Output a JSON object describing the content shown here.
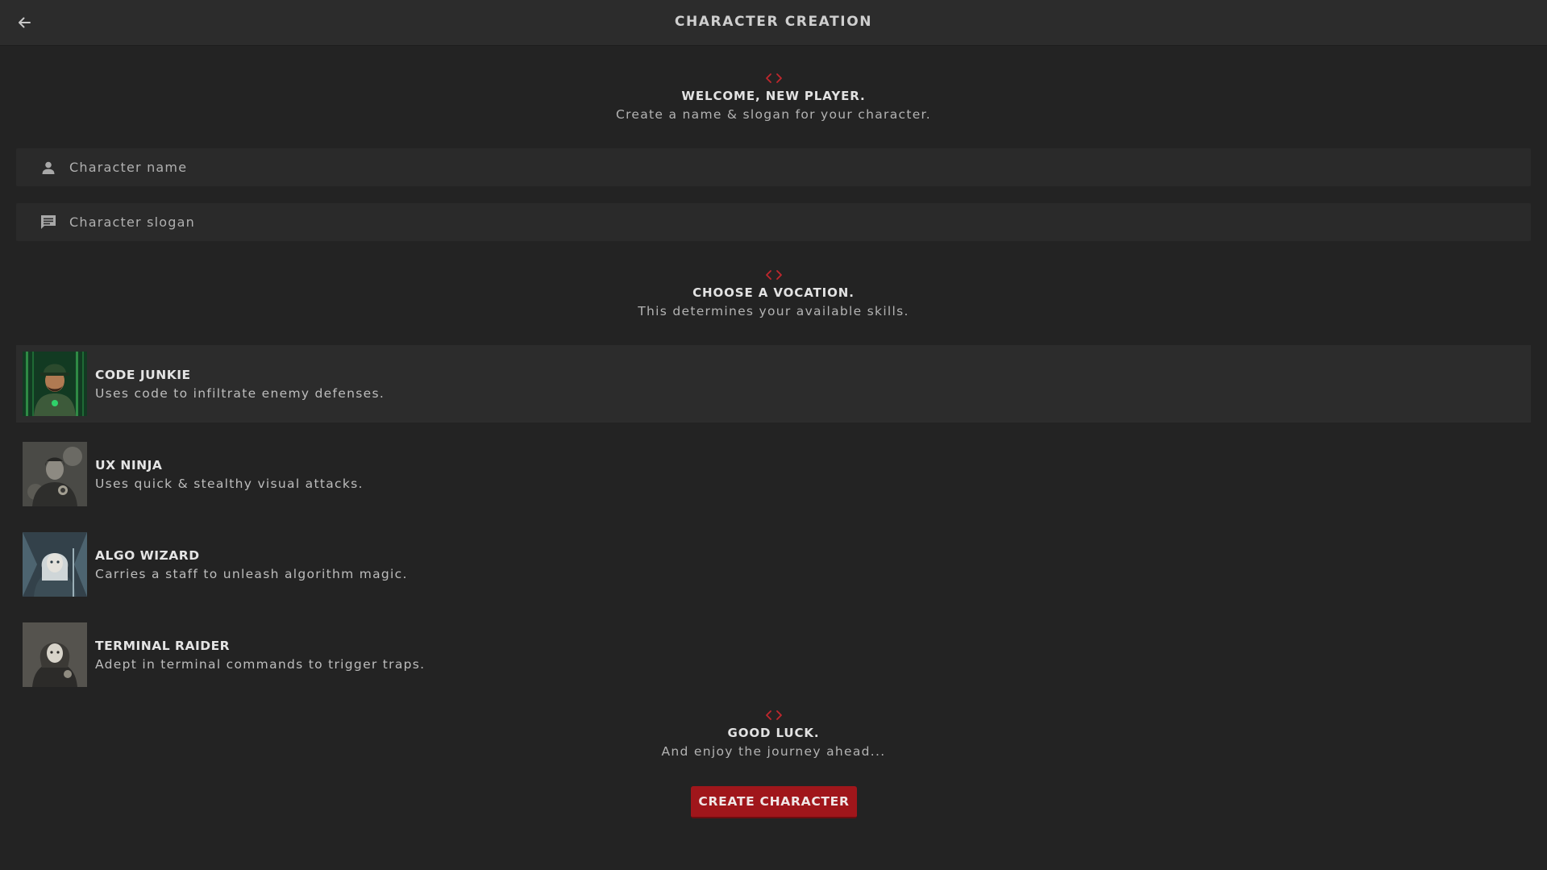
{
  "header": {
    "title": "CHARACTER CREATION",
    "back_icon": "arrow-left-icon"
  },
  "welcome": {
    "heading": "WELCOME, NEW PLAYER.",
    "subtext": "Create a name & slogan for your character."
  },
  "fields": {
    "name": {
      "placeholder": "Character name",
      "value": "",
      "icon": "person-icon"
    },
    "slogan": {
      "placeholder": "Character slogan",
      "value": "",
      "icon": "chat-icon"
    }
  },
  "vocation_section": {
    "heading": "CHOOSE A VOCATION.",
    "subtext": "This determines your available skills."
  },
  "vocations": [
    {
      "name": "CODE JUNKIE",
      "description": "Uses code to infiltrate enemy defenses.",
      "selected": true
    },
    {
      "name": "UX NINJA",
      "description": "Uses quick & stealthy visual attacks.",
      "selected": false
    },
    {
      "name": "ALGO WIZARD",
      "description": "Carries a staff to unleash algorithm magic.",
      "selected": false
    },
    {
      "name": "TERMINAL RAIDER",
      "description": "Adept in terminal commands to trigger traps.",
      "selected": false
    }
  ],
  "farewell": {
    "heading": "GOOD LUCK.",
    "subtext": "And enjoy the journey ahead..."
  },
  "actions": {
    "create_label": "CREATE CHARACTER"
  },
  "colors": {
    "accent": "#a0161b",
    "background": "#232323",
    "panel": "#2c2c2c",
    "glyph": "#c0272d"
  }
}
